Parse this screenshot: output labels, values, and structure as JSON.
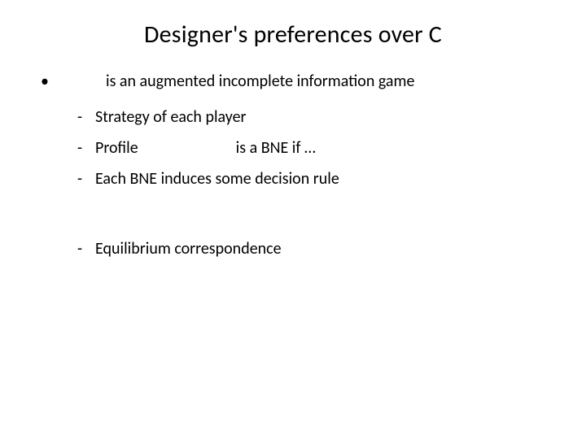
{
  "title": "Designer's preferences over C",
  "main_bullet": {
    "marker": "•",
    "text": "is an augmented incomplete information game"
  },
  "items": [
    {
      "marker": "-",
      "text": "Strategy of each player"
    },
    {
      "marker": "-",
      "prefix": "Profile",
      "suffix": "is a BNE  if …"
    },
    {
      "marker": "-",
      "text": "Each BNE induces some decision rule"
    },
    {
      "marker": "-",
      "text": "Equilibrium correspondence"
    }
  ]
}
